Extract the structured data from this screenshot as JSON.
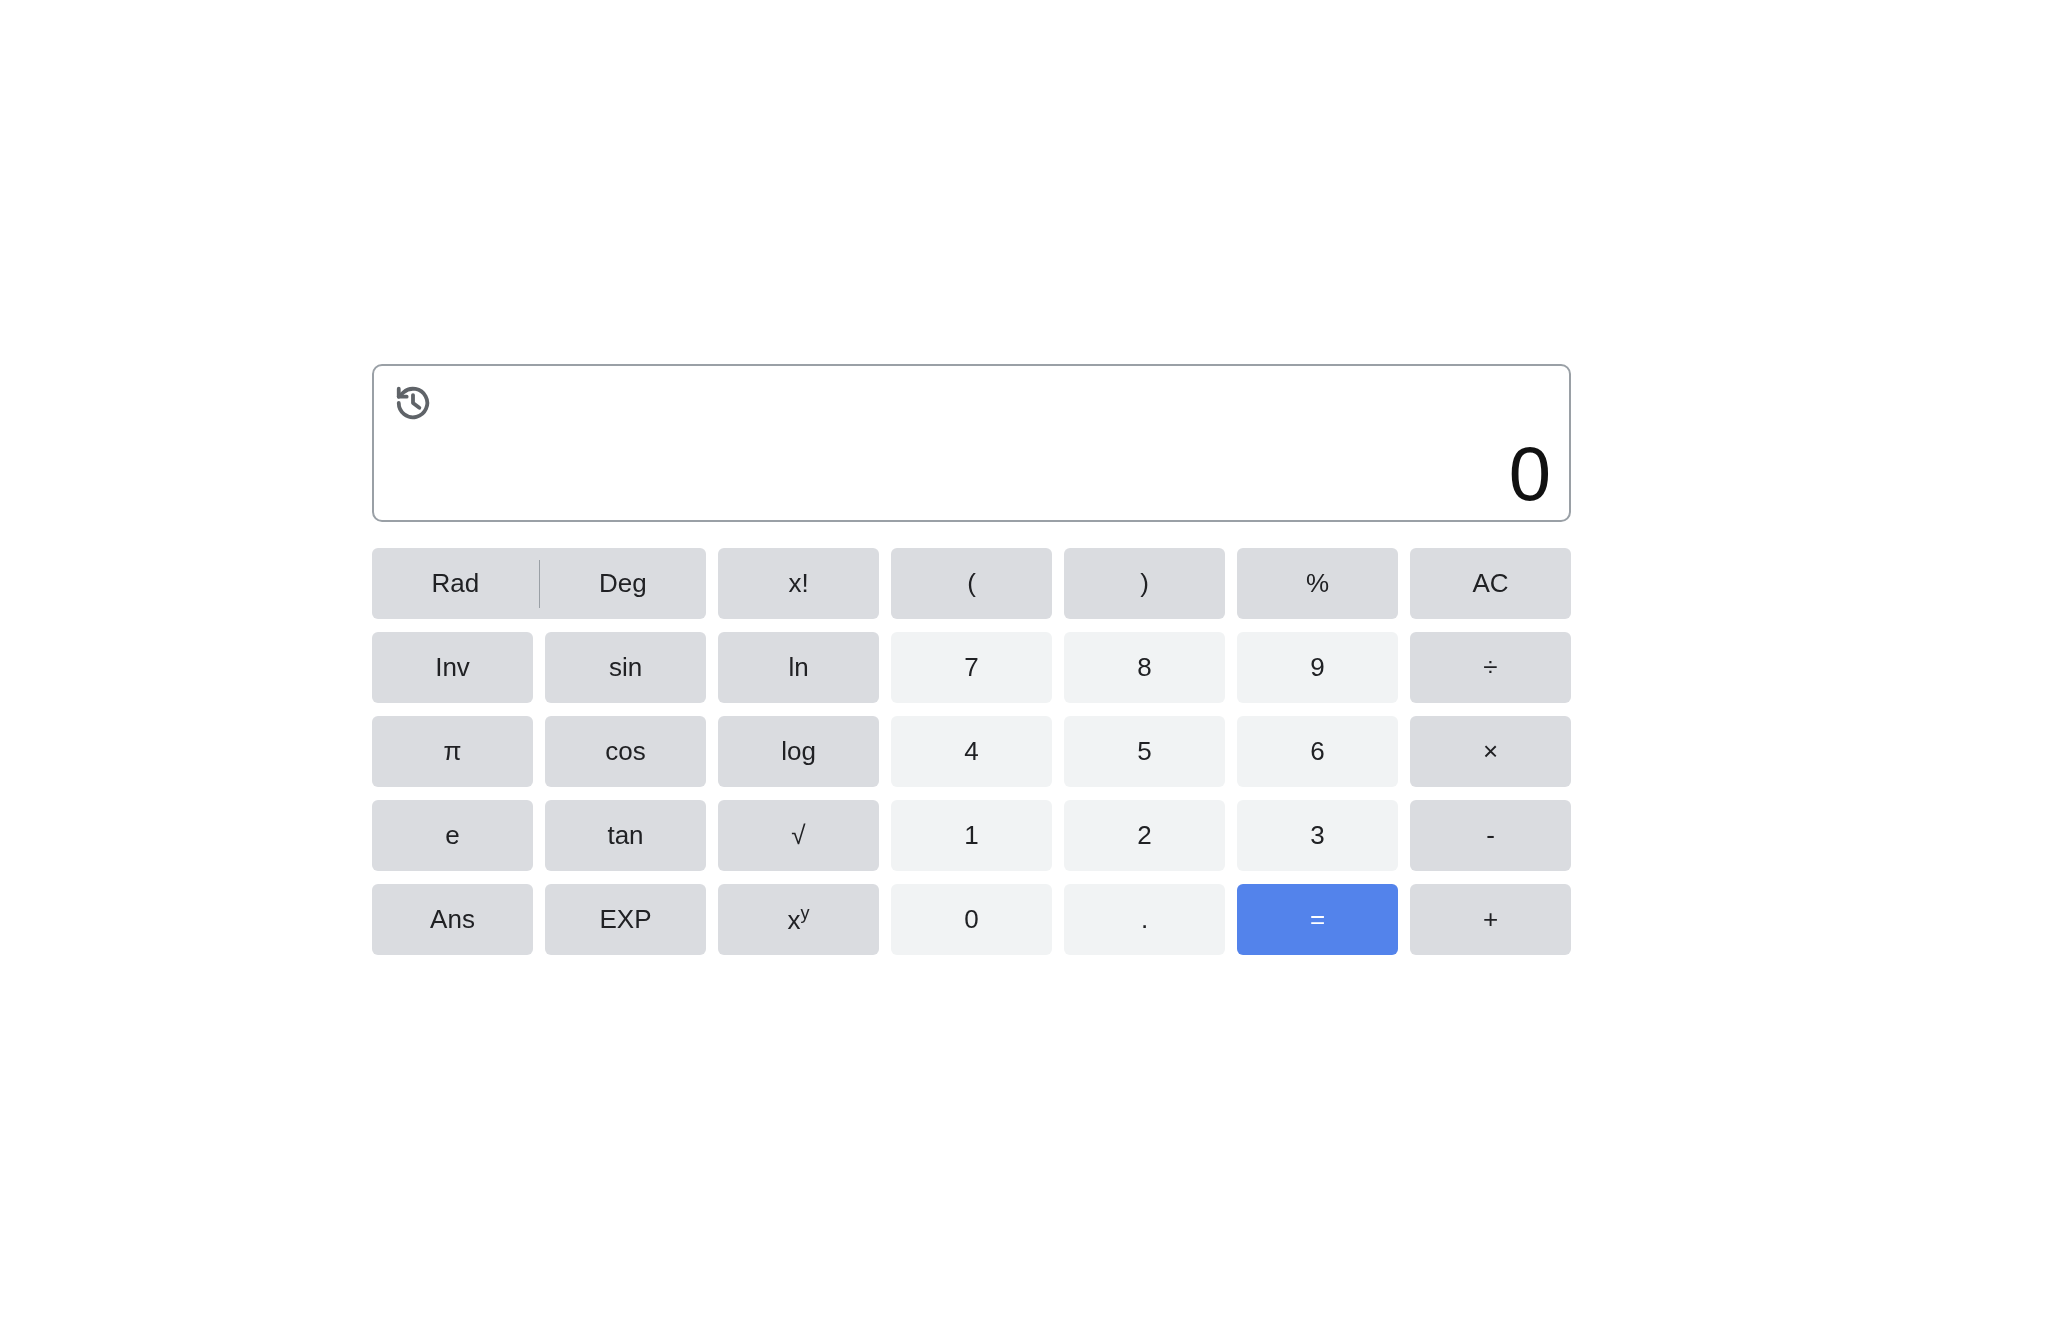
{
  "display": {
    "value": "0"
  },
  "angle_toggle": [
    "Rad",
    "Deg"
  ],
  "keys": [
    {
      "label": "x!",
      "kind": "function"
    },
    {
      "label": "(",
      "kind": "function"
    },
    {
      "label": ")",
      "kind": "function"
    },
    {
      "label": "%",
      "kind": "function"
    },
    {
      "label": "AC",
      "kind": "function"
    },
    {
      "label": "Inv",
      "kind": "function"
    },
    {
      "label": "sin",
      "kind": "function"
    },
    {
      "label": "ln",
      "kind": "function"
    },
    {
      "label": "7",
      "kind": "digit"
    },
    {
      "label": "8",
      "kind": "digit"
    },
    {
      "label": "9",
      "kind": "digit"
    },
    {
      "label": "÷",
      "kind": "function"
    },
    {
      "label": "π",
      "kind": "function"
    },
    {
      "label": "cos",
      "kind": "function"
    },
    {
      "label": "log",
      "kind": "function"
    },
    {
      "label": "4",
      "kind": "digit"
    },
    {
      "label": "5",
      "kind": "digit"
    },
    {
      "label": "6",
      "kind": "digit"
    },
    {
      "label": "×",
      "kind": "function"
    },
    {
      "label": "e",
      "kind": "function"
    },
    {
      "label": "tan",
      "kind": "function"
    },
    {
      "label": "√",
      "kind": "function"
    },
    {
      "label": "1",
      "kind": "digit"
    },
    {
      "label": "2",
      "kind": "digit"
    },
    {
      "label": "3",
      "kind": "digit"
    },
    {
      "label": "-",
      "kind": "function"
    },
    {
      "label": "Ans",
      "kind": "function"
    },
    {
      "label": "EXP",
      "kind": "function"
    },
    {
      "label": "x$^{y}$",
      "kind": "function"
    },
    {
      "label": "0",
      "kind": "digit"
    },
    {
      "label": ".",
      "kind": "digit"
    },
    {
      "label": "=",
      "kind": "equals"
    },
    {
      "label": "+",
      "kind": "function"
    }
  ]
}
